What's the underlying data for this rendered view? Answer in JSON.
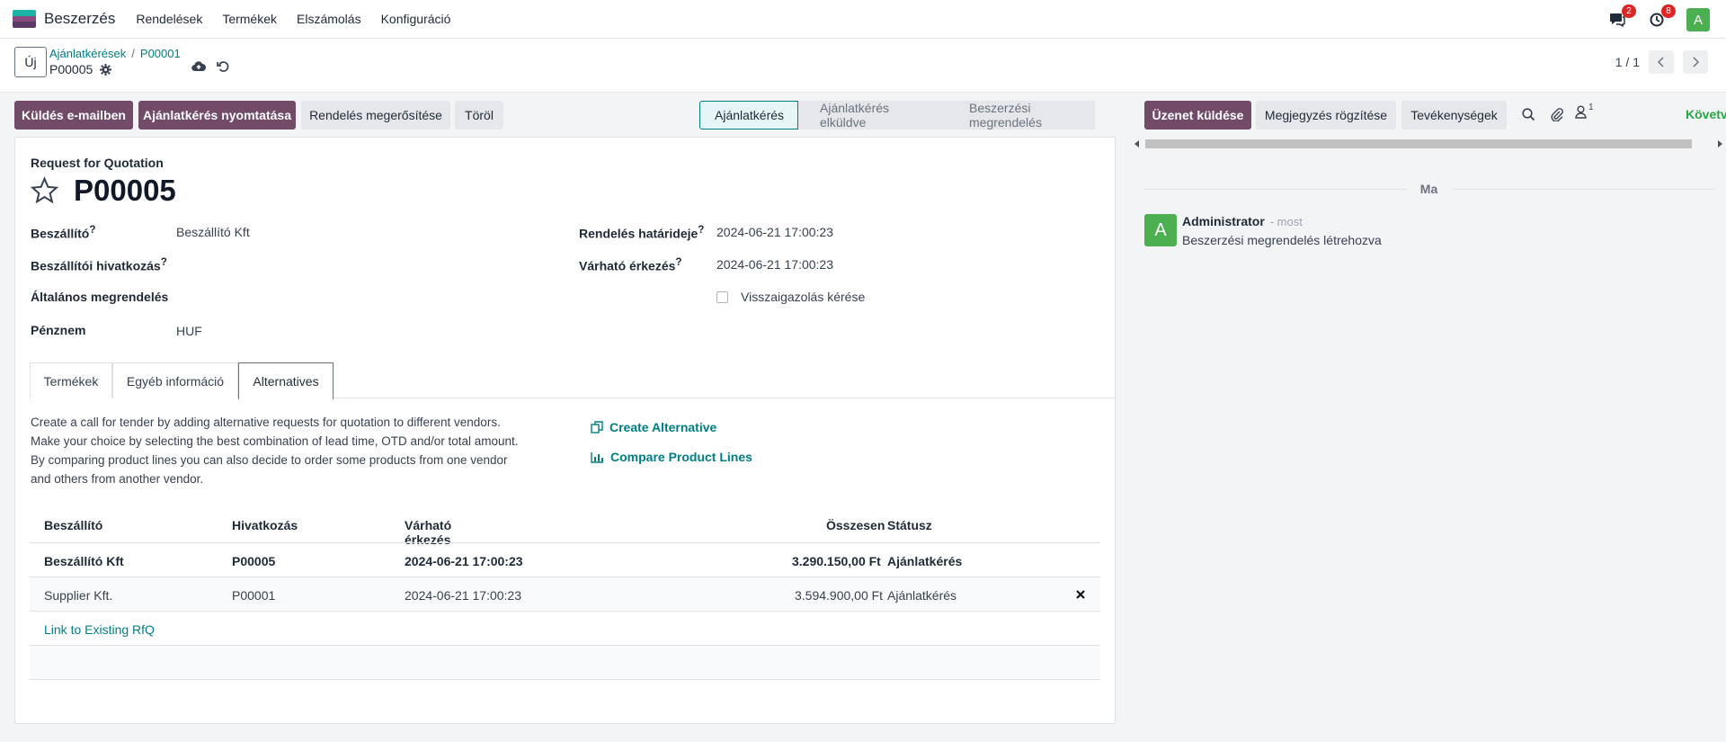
{
  "navbar": {
    "app_name": "Beszerzés",
    "menu": [
      "Rendelések",
      "Termékek",
      "Elszámolás",
      "Konfiguráció"
    ],
    "messages_count": "2",
    "activities_count": "8",
    "user_initial": "A",
    "colors": {
      "user_avatar": "#4caf50",
      "badge": "#dc2626"
    }
  },
  "control": {
    "new_label": "Új",
    "breadcrumb": [
      "Ajánlatkérések",
      "P00001"
    ],
    "record_name": "P00005",
    "pager": "1 / 1"
  },
  "actions": {
    "buttons": [
      "Küldés e-mailben",
      "Ajánlatkérés nyomtatása",
      "Rendelés megerősítése",
      "Töröl"
    ]
  },
  "statusbar": {
    "stages": [
      "Ajánlatkérés",
      "Ajánlatkérés elküldve",
      "Beszerzési megrendelés"
    ],
    "active": "Ajánlatkérés"
  },
  "form": {
    "type_label": "Request for Quotation",
    "title": "P00005",
    "left_fields": [
      {
        "label": "Beszállító",
        "help": "?",
        "value": "Beszállító Kft"
      },
      {
        "label": "Beszállítói hivatkozás",
        "help": "?",
        "value": ""
      },
      {
        "label": "Általános megrendelés",
        "help": "",
        "value": ""
      },
      {
        "label": "Pénznem",
        "help": "",
        "value": "HUF"
      }
    ],
    "right_fields": [
      {
        "label": "Rendelés határideje",
        "help": "?",
        "value": "2024-06-21 17:00:23"
      },
      {
        "label": "Várható érkezés",
        "help": "?",
        "value": "2024-06-21 17:00:23"
      }
    ],
    "ack_label": "Visszaigazolás kérése",
    "tabs": [
      "Termékek",
      "Egyéb információ",
      "Alternatives"
    ],
    "active_tab": "Alternatives"
  },
  "alternatives": {
    "desc": [
      "Create a call for tender by adding alternative requests for quotation to different vendors.",
      "Make your choice by selecting the best combination of lead time, OTD and/or total amount.",
      "By comparing product lines you can also decide to order some products from one vendor",
      "and others from another vendor."
    ],
    "create_label": "Create Alternative",
    "compare_label": "Compare Product Lines",
    "headers": [
      "Beszállító",
      "Hivatkozás",
      "Várható érkezés",
      "Összesen",
      "Státusz"
    ],
    "rows": [
      {
        "vendor": "Beszállító Kft",
        "ref": "P00005",
        "date": "2024-06-21 17:00:23",
        "total": "3.290.150,00 Ft",
        "status": "Ajánlatkérés"
      },
      {
        "vendor": "Supplier Kft.",
        "ref": "P00001",
        "date": "2024-06-21 17:00:23",
        "total": "3.594.900,00 Ft",
        "status": "Ajánlatkérés"
      }
    ],
    "link_existing": "Link to Existing RfQ"
  },
  "chatter": {
    "send_message": "Üzenet küldése",
    "log_note": "Megjegyzés rögzítése",
    "activities": "Tevékenységek",
    "followers_count": "1",
    "follow": "Követve",
    "today": "Ma",
    "author_initial": "A",
    "author": "Administrator",
    "time": "- most",
    "body": "Beszerzési megrendelés létrehozva"
  },
  "colors": {
    "primary": "#714b67",
    "link": "#017e84"
  }
}
